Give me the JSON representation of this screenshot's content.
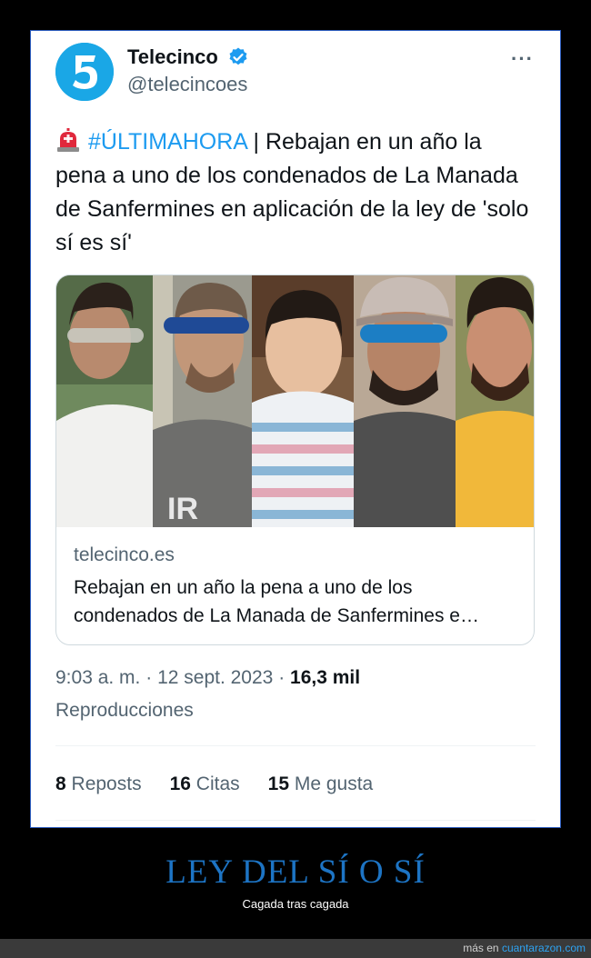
{
  "tweet": {
    "account_name": "Telecinco",
    "handle": "@telecincoes",
    "avatar_glyph": "5",
    "more_label": "···",
    "alert_icon": "police-siren-icon",
    "hashtag": "#ÚLTIMAHORA",
    "body": " | Rebajan en un año la pena a uno de los condenados de La Manada de Sanfermines en aplicación de la ley de 'solo sí es sí'",
    "link_card": {
      "domain": "telecinco.es",
      "headline": "Rebajan en un año la pena a uno de los condenados de La Manada de Sanfermines e…"
    },
    "time": "9:03 a. m.",
    "date": "12 sept. 2023",
    "views_count": "16,3 mil",
    "views_label": "Reproducciones",
    "separator": "·",
    "stats": {
      "reposts_count": "8",
      "reposts_label": "Reposts",
      "quotes_count": "16",
      "quotes_label": "Citas",
      "likes_count": "15",
      "likes_label": "Me gusta"
    }
  },
  "meme": {
    "title": "LEY DEL SÍ O SÍ",
    "subtitle": "Cagada tras cagada"
  },
  "footer": {
    "prefix": "más en ",
    "site": "cuantarazon.com"
  },
  "colors": {
    "accent": "#1d9bf0",
    "meme_title": "#1d74c4",
    "frame_border": "#2b5bbd"
  }
}
